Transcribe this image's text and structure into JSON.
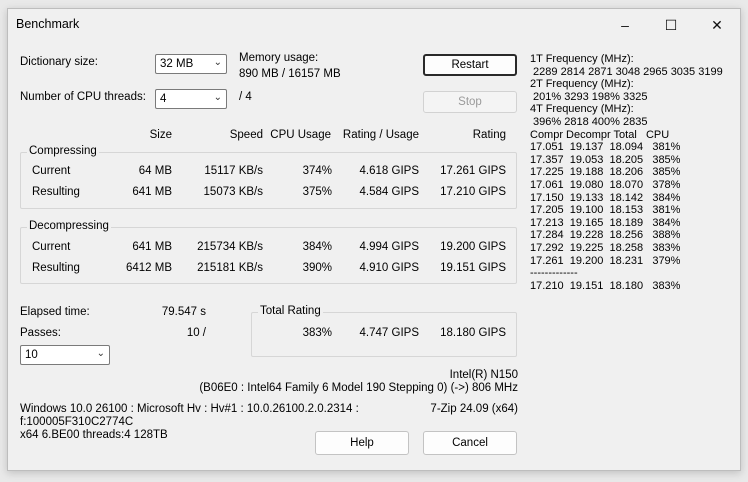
{
  "window": {
    "title": "Benchmark"
  },
  "titlebar_buttons": [
    "–",
    "☐",
    "✕"
  ],
  "settings": {
    "dict_label": "Dictionary size:",
    "dict_value": "32 MB",
    "threads_label": "Number of CPU threads:",
    "threads_value": "4",
    "threads_total": "/ 4",
    "mem_label": "Memory usage:",
    "mem_value": "890 MB / 16157 MB"
  },
  "buttons": {
    "restart": "Restart",
    "stop": "Stop",
    "help": "Help",
    "cancel": "Cancel"
  },
  "headers": {
    "size": "Size",
    "speed": "Speed",
    "cpu": "CPU Usage",
    "rating_usage": "Rating / Usage",
    "rating": "Rating"
  },
  "compressing": {
    "label": "Compressing",
    "rows": [
      {
        "name": "Current",
        "size": "64 MB",
        "speed": "15117 KB/s",
        "cpu": "374%",
        "ru": "4.618 GIPS",
        "rating": "17.261 GIPS"
      },
      {
        "name": "Resulting",
        "size": "641 MB",
        "speed": "15073 KB/s",
        "cpu": "375%",
        "ru": "4.584 GIPS",
        "rating": "17.210 GIPS"
      }
    ]
  },
  "decompressing": {
    "label": "Decompressing",
    "rows": [
      {
        "name": "Current",
        "size": "641 MB",
        "speed": "215734 KB/s",
        "cpu": "384%",
        "ru": "4.994 GIPS",
        "rating": "19.200 GIPS"
      },
      {
        "name": "Resulting",
        "size": "6412 MB",
        "speed": "215181 KB/s",
        "cpu": "390%",
        "ru": "4.910 GIPS",
        "rating": "19.151 GIPS"
      }
    ]
  },
  "elapsed": {
    "label": "Elapsed time:",
    "value": "79.547 s"
  },
  "passes": {
    "label": "Passes:",
    "value": "10 /",
    "select_value": "10"
  },
  "total": {
    "label": "Total Rating",
    "cpu": "383%",
    "ru": "4.747 GIPS",
    "rating": "18.180 GIPS"
  },
  "cpu_info": {
    "name": "Intel(R) N150",
    "detail": "(B06E0 : Intel64 Family 6 Model 190 Stepping 0) (->) 806 MHz",
    "os_line": "Windows 10.0 26100 : Microsoft Hv : Hv#1 : 10.0.26100.2.0.2314 :",
    "id_line": "f:100005F310C2774C",
    "arch_line": "x64 6.BE00 threads:4 128TB",
    "version": "7-Zip 24.09 (x64)"
  },
  "right_panel": [
    "1T Frequency (MHz):",
    " 2289 2814 2871 3048 2965 3035 3199",
    "2T Frequency (MHz):",
    " 201% 3293 198% 3325",
    "4T Frequency (MHz):",
    " 396% 2818 400% 2835",
    "Compr Decompr Total   CPU",
    "17.051  19.137  18.094   381%",
    "17.357  19.053  18.205   385%",
    "17.225  19.188  18.206   385%",
    "17.061  19.080  18.070   378%",
    "17.150  19.133  18.142   384%",
    "17.205  19.100  18.153   381%",
    "17.213  19.165  18.189   384%",
    "17.284  19.228  18.256   388%",
    "17.292  19.225  18.258   383%",
    "17.261  19.200  18.231   379%",
    "-------------",
    "17.210  19.151  18.180   383%"
  ]
}
